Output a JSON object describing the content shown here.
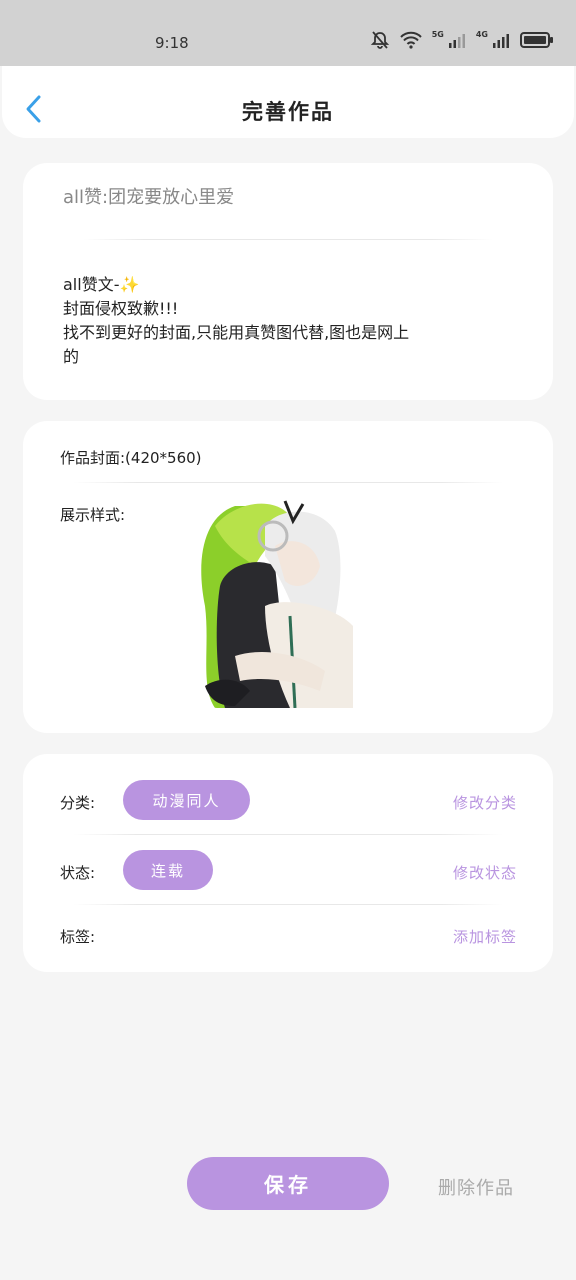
{
  "status_bar": {
    "time": "9:18",
    "net1": "5G",
    "net2": "4G"
  },
  "header": {
    "title": "完善作品",
    "back_icon": "chevron-left-icon"
  },
  "work": {
    "title": "all赞:团宠要放心里爱",
    "description_lines": [
      "all赞文-✨",
      "封面侵权致歉!!!",
      "找不到更好的封面,只能用真赞图代替,图也是网上",
      "的"
    ]
  },
  "cover": {
    "label": "作品封面:(420*560)",
    "display_label": "展示样式:"
  },
  "meta": {
    "category_label": "分类:",
    "category_value": "动漫同人",
    "category_action": "修改分类",
    "status_label": "状态:",
    "status_value": "连载",
    "status_action": "修改状态",
    "tags_label": "标签:",
    "tags_action": "添加标签"
  },
  "footer": {
    "save_label": "保存",
    "delete_label": "删除作品"
  },
  "colors": {
    "accent": "#b994e0",
    "back": "#3aa0e8",
    "bg": "#f5f5f5"
  }
}
